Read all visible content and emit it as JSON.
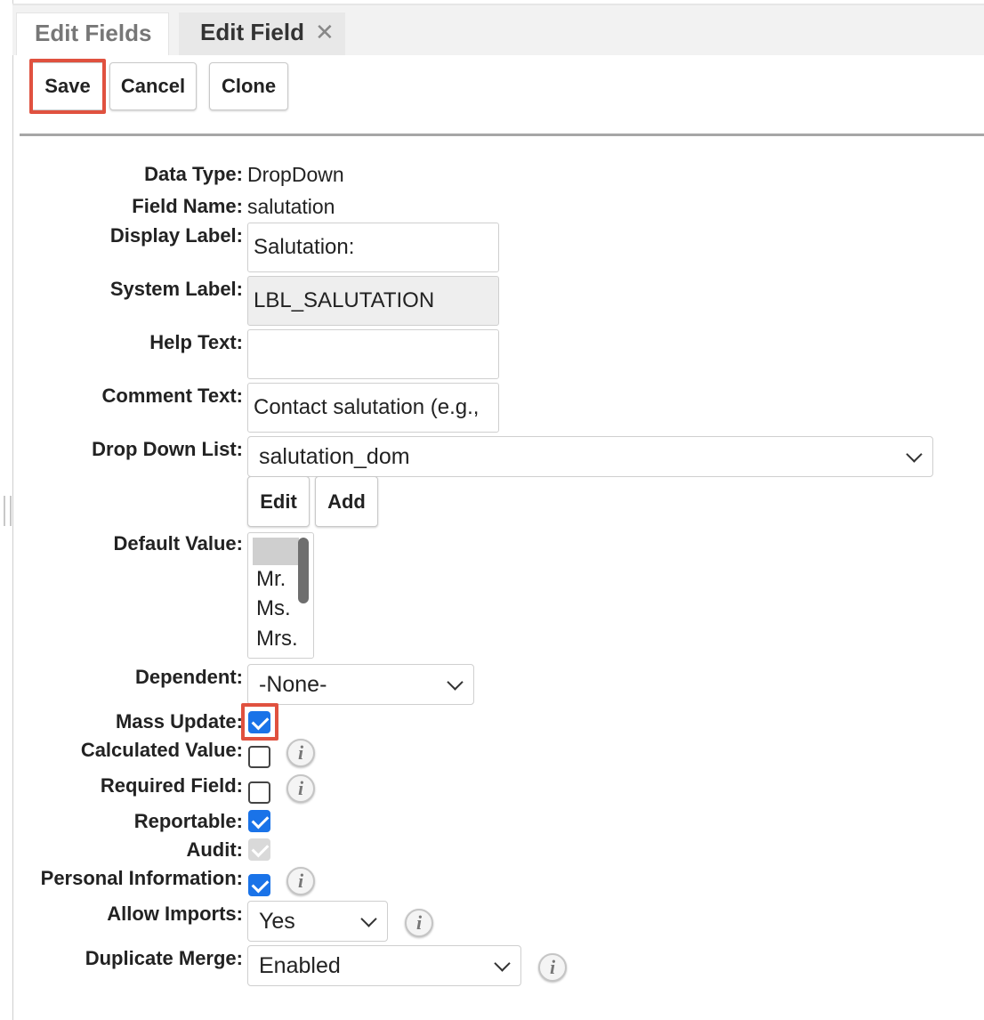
{
  "tabs": [
    {
      "label": "Edit Fields"
    },
    {
      "label": "Edit Field",
      "close_icon": "close-icon",
      "close_glyph": "✕"
    }
  ],
  "toolbar": {
    "save_label": "Save",
    "cancel_label": "Cancel",
    "clone_label": "Clone"
  },
  "form": {
    "data_type": {
      "label": "Data Type:",
      "value": "DropDown"
    },
    "field_name": {
      "label": "Field Name:",
      "value": "salutation"
    },
    "display_label": {
      "label": "Display Label:",
      "value": "Salutation:"
    },
    "system_label": {
      "label": "System Label:",
      "value": "LBL_SALUTATION"
    },
    "help_text": {
      "label": "Help Text:",
      "value": ""
    },
    "comment_text": {
      "label": "Comment Text:",
      "value": "Contact salutation (e.g., Mr., Ms.)",
      "display": "Contact salutation (e.g.,"
    },
    "drop_down_list": {
      "label": "Drop Down List:",
      "value": "salutation_dom",
      "edit_label": "Edit",
      "add_label": "Add"
    },
    "default_value": {
      "label": "Default Value:",
      "options": [
        "",
        "Mr.",
        "Ms.",
        "Mrs."
      ],
      "selected": ""
    },
    "dependent": {
      "label": "Dependent:",
      "value": "-None-"
    },
    "mass_update": {
      "label": "Mass Update:",
      "checked": true
    },
    "calculated_value": {
      "label": "Calculated Value:",
      "checked": false
    },
    "required_field": {
      "label": "Required Field:",
      "checked": false
    },
    "reportable": {
      "label": "Reportable:",
      "checked": true
    },
    "audit": {
      "label": "Audit:",
      "checked": true,
      "disabled": true
    },
    "personal_information": {
      "label": "Personal Information:",
      "checked": true
    },
    "allow_imports": {
      "label": "Allow Imports:",
      "value": "Yes"
    },
    "duplicate_merge": {
      "label": "Duplicate Merge:",
      "value": "Enabled"
    }
  },
  "info_icon": {
    "glyph": "i",
    "name": "info-icon"
  },
  "colors": {
    "highlight": "#e0513f",
    "checkbox_checked": "#1a73e8"
  }
}
